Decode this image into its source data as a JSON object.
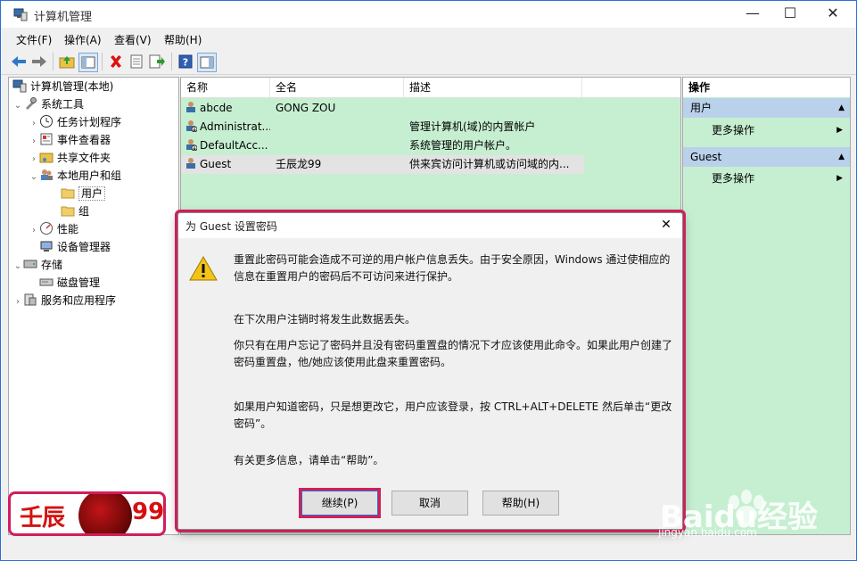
{
  "window": {
    "title": "计算机管理",
    "controls": {
      "minimize": "—",
      "maximize": "☐",
      "close": "✕"
    }
  },
  "menu": [
    "文件(F)",
    "操作(A)",
    "查看(V)",
    "帮助(H)"
  ],
  "tree": {
    "root": "计算机管理(本地)",
    "system_tools": "系统工具",
    "task_scheduler": "任务计划程序",
    "event_viewer": "事件查看器",
    "shared_folders": "共享文件夹",
    "local_users_groups": "本地用户和组",
    "users": "用户",
    "groups": "组",
    "performance": "性能",
    "device_manager": "设备管理器",
    "storage": "存储",
    "disk_management": "磁盘管理",
    "services_apps": "服务和应用程序"
  },
  "list": {
    "columns": [
      "名称",
      "全名",
      "描述"
    ],
    "rows": [
      {
        "name": "abcde",
        "fullname": "GONG ZOU",
        "desc": ""
      },
      {
        "name": "Administrat...",
        "fullname": "",
        "desc": "管理计算机(域)的内置帐户"
      },
      {
        "name": "DefaultAcc...",
        "fullname": "",
        "desc": "系统管理的用户帐户。"
      },
      {
        "name": "Guest",
        "fullname": "壬辰龙99",
        "desc": "供来宾访问计算机或访问域的内..."
      }
    ]
  },
  "actions": {
    "header": "操作",
    "section1": "用户",
    "more1": "更多操作",
    "section2": "Guest",
    "more2": "更多操作"
  },
  "dialog": {
    "title": "为 Guest 设置密码",
    "p1": "重置此密码可能会造成不可逆的用户帐户信息丢失。由于安全原因，Windows 通过使相应的信息在重置用户的密码后不可访问来进行保护。",
    "p2": "在下次用户注销时将发生此数据丢失。",
    "p3": "你只有在用户忘记了密码并且没有密码重置盘的情况下才应该使用此命令。如果此用户创建了密码重置盘，他/她应该使用此盘来重置密码。",
    "p4": "如果用户知道密码，只是想更改它，用户应该登录，按 CTRL+ALT+DELETE 然后单击“更改密码”。",
    "p5": "有关更多信息，请单击“帮助”。",
    "btn_continue": "继续(P)",
    "btn_cancel": "取消",
    "btn_help": "帮助(H)",
    "close": "✕"
  },
  "badge": {
    "left": "壬辰",
    "right": "99"
  },
  "watermark": {
    "text": "Baidu经验",
    "url": "jingyan.baidu.com"
  },
  "colors": {
    "highlight": "#d01f5c",
    "list_bg": "#c6efd1",
    "section_bg": "#b9d1ea"
  }
}
